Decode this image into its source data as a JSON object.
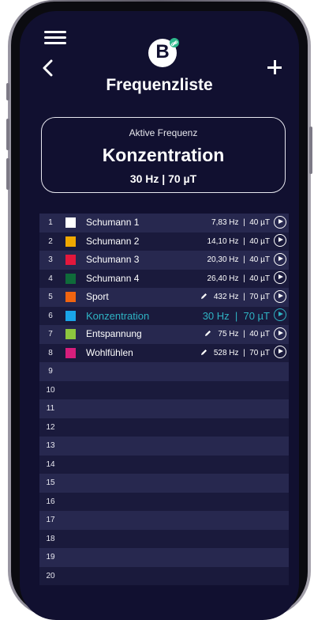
{
  "header": {
    "title": "Frequenzliste",
    "logo_letter": "B",
    "menu_icon": "hamburger-menu-icon",
    "back_icon": "chevron-left-icon",
    "add_icon": "plus-icon"
  },
  "active_frequency": {
    "label": "Aktive Frequenz",
    "name": "Konzentration",
    "values": "30 Hz | 70 µT"
  },
  "colors": {
    "background": "#111030",
    "accent": "#2fb3c3",
    "logo_badge": "#2fb98d"
  },
  "rows": [
    {
      "num": "1",
      "name": "Schumann 1",
      "vals": "7,83 Hz  |  40 µT",
      "color": "#ffffff",
      "editable": false,
      "active": false
    },
    {
      "num": "2",
      "name": "Schumann 2",
      "vals": "14,10 Hz  |  40 µT",
      "color": "#f0a800",
      "editable": false,
      "active": false
    },
    {
      "num": "3",
      "name": "Schumann 3",
      "vals": "20,30 Hz  |  40 µT",
      "color": "#e3173c",
      "editable": false,
      "active": false
    },
    {
      "num": "4",
      "name": "Schumann 4",
      "vals": "26,40 Hz  |  40 µT",
      "color": "#0f6b3a",
      "editable": false,
      "active": false
    },
    {
      "num": "5",
      "name": "Sport",
      "vals": "432 Hz  |  70 µT",
      "color": "#f06410",
      "editable": true,
      "active": false
    },
    {
      "num": "6",
      "name": "Konzentration",
      "vals": "30 Hz  |  70 µT",
      "color": "#1aa5e8",
      "editable": false,
      "active": true
    },
    {
      "num": "7",
      "name": "Entspannung",
      "vals": "75 Hz  |  40 µT",
      "color": "#8dc63f",
      "editable": true,
      "active": false
    },
    {
      "num": "8",
      "name": "Wohlfühlen",
      "vals": "528 Hz  |  70 µT",
      "color": "#d61e7c",
      "editable": true,
      "active": false
    },
    {
      "num": "9"
    },
    {
      "num": "10"
    },
    {
      "num": "11"
    },
    {
      "num": "12"
    },
    {
      "num": "13"
    },
    {
      "num": "14"
    },
    {
      "num": "15"
    },
    {
      "num": "16"
    },
    {
      "num": "17"
    },
    {
      "num": "18"
    },
    {
      "num": "19"
    },
    {
      "num": "20"
    }
  ]
}
